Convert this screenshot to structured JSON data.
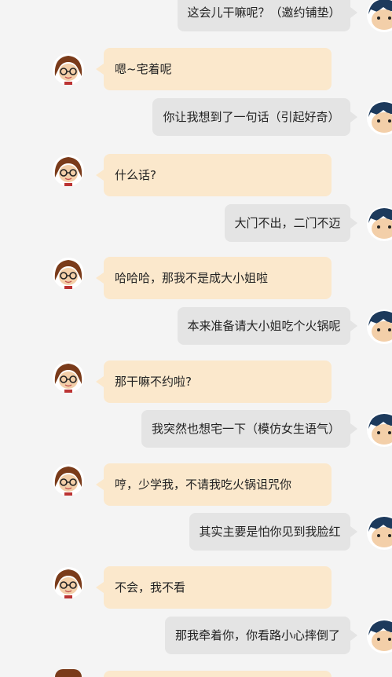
{
  "messages": [
    {
      "side": "right",
      "text": "这会儿干嘛呢？（邀约铺垫）"
    },
    {
      "side": "left",
      "text": "嗯~宅着呢"
    },
    {
      "side": "right",
      "text": "你让我想到了一句话（引起好奇）"
    },
    {
      "side": "left",
      "text": "什么话?"
    },
    {
      "side": "right",
      "text": "大门不出，二门不迈"
    },
    {
      "side": "left",
      "text": "哈哈哈，那我不是成大小姐啦"
    },
    {
      "side": "right",
      "text": "本来准备请大小姐吃个火锅呢"
    },
    {
      "side": "left",
      "text": "那干嘛不约啦?"
    },
    {
      "side": "right",
      "text": "我突然也想宅一下（模仿女生语气）"
    },
    {
      "side": "left",
      "text": "哼，少学我，不请我吃火锅诅咒你"
    },
    {
      "side": "right",
      "text": "其实主要是怕你见到我脸红"
    },
    {
      "side": "left",
      "text": "不会，我不看"
    },
    {
      "side": "right",
      "text": "那我牵着你，你看路小心摔倒了"
    }
  ],
  "colors": {
    "background": "#f4f4f4",
    "left_bubble": "#fbe8cc",
    "right_bubble": "#e4e4e4"
  },
  "icons": {
    "female": "girl-avatar-icon",
    "male": "boy-avatar-icon"
  }
}
